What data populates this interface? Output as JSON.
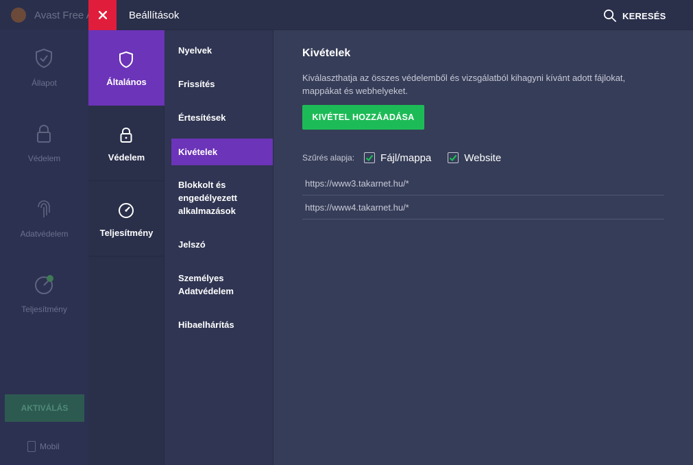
{
  "background_app": {
    "title": "Avast Free A",
    "sidebar": [
      {
        "label": "Állapot",
        "icon": "shield-check-icon"
      },
      {
        "label": "Védelem",
        "icon": "lock-icon"
      },
      {
        "label": "Adatvédelem",
        "icon": "fingerprint-icon"
      },
      {
        "label": "Teljesítmény",
        "icon": "gauge-icon"
      }
    ],
    "activate_label": "AKTIVÁLÁS",
    "mobile_label": "Mobil"
  },
  "settings": {
    "title": "Beállítások",
    "search_label": "KERESÉS",
    "categories": [
      {
        "label": "Általános",
        "icon": "shield-icon",
        "active": true
      },
      {
        "label": "Védelem",
        "icon": "lock-icon",
        "active": false
      },
      {
        "label": "Teljesítmény",
        "icon": "speedometer-icon",
        "active": false
      }
    ],
    "subsections": [
      {
        "label": "Nyelvek"
      },
      {
        "label": "Frissítés"
      },
      {
        "label": "Értesítések"
      },
      {
        "label": "Kivételek",
        "active": true
      },
      {
        "label": "Blokkolt és engedélyezett alkalmazások"
      },
      {
        "label": "Jelszó"
      },
      {
        "label": "Személyes Adatvédelem"
      },
      {
        "label": "Hibaelhárítás"
      }
    ]
  },
  "main": {
    "heading": "Kivételek",
    "description": "Kiválaszthatja az összes védelemből és vizsgálatból kihagyni kívánt adott fájlokat, mappákat és webhelyeket.",
    "add_button": "KIVÉTEL HOZZÁADÁSA",
    "filter": {
      "label": "Szűrés alapja:",
      "options": [
        {
          "label": "Fájl/mappa",
          "checked": true
        },
        {
          "label": "Website",
          "checked": true
        }
      ]
    },
    "exceptions": [
      "https://www3.takarnet.hu/*",
      "https://www4.takarnet.hu/*"
    ]
  },
  "colors": {
    "accent_purple": "#6c34b8",
    "close_red": "#e01e3c",
    "add_green": "#1dbb57",
    "check_green": "#1dbb57"
  }
}
